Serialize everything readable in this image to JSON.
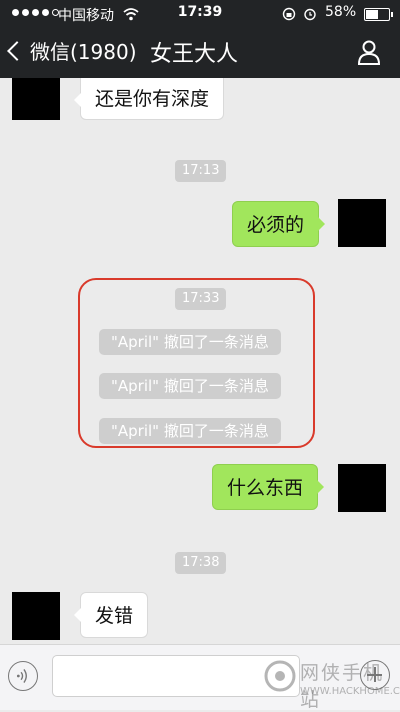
{
  "status_bar": {
    "carrier": "中国移动",
    "time": "17:39",
    "battery_percent": "58%",
    "battery_level": 0.58
  },
  "nav": {
    "back_label": "微信(1980)",
    "title": "女王大人"
  },
  "messages": {
    "m1_text": "还是你有深度",
    "t1": "17:13",
    "m2_text": "必须的",
    "t2": "17:33",
    "recalled": [
      "\"April\" 撤回了一条消息",
      "\"April\" 撤回了一条消息",
      "\"April\" 撤回了一条消息"
    ],
    "m3_text": "什么东西",
    "t3": "17:38",
    "m4_text": "发错"
  },
  "watermark": {
    "line1": "网侠手机站",
    "line2": "WWW.HACKHOME.COM"
  },
  "colors": {
    "nav_bg": "#222426",
    "chat_bg": "#ebebeb",
    "outgoing_bubble": "#a1e65c",
    "highlight": "#d93a2b"
  }
}
